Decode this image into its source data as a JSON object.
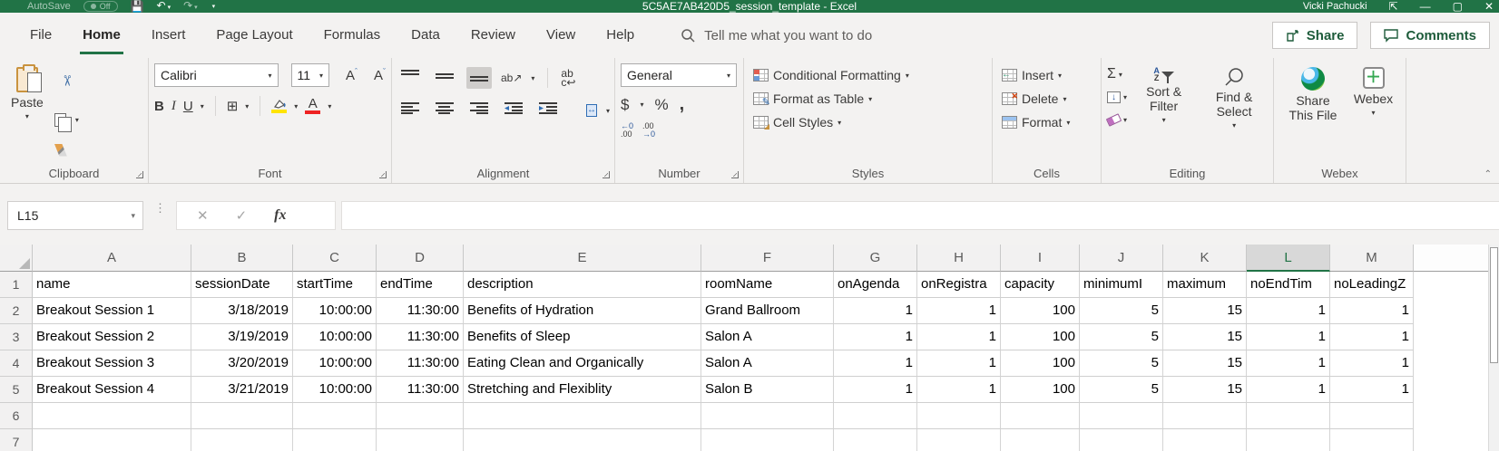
{
  "colors": {
    "accent_green": "#217346",
    "fill_yellow": "#ffe400",
    "font_red": "#ee2222"
  },
  "title_bar": {
    "autosave_label": "AutoSave",
    "autosave_state": "Off",
    "document_title": "5C5AE7AB420D5_session_template  -  Excel",
    "user_name": "Vicki Pachucki"
  },
  "tabs": {
    "labels": [
      "File",
      "Home",
      "Insert",
      "Page Layout",
      "Formulas",
      "Data",
      "Review",
      "View",
      "Help"
    ],
    "active": "Home"
  },
  "search": {
    "label": "Tell me what you want to do"
  },
  "actions": {
    "share": "Share",
    "comments": "Comments"
  },
  "ribbon": {
    "clipboard": {
      "group_label": "Clipboard",
      "paste": "Paste"
    },
    "font": {
      "group_label": "Font",
      "font_name": "Calibri",
      "font_size": "11",
      "bold": "B",
      "italic": "I",
      "underline": "U",
      "color_letter": "A"
    },
    "alignment": {
      "group_label": "Alignment",
      "wrap_text": "abc",
      "orientation": "ab"
    },
    "number": {
      "group_label": "Number",
      "format": "General",
      "currency": "$",
      "percent": "%",
      "comma": ",",
      "inc_decimal_top": "←0",
      "inc_decimal_bottom": ".00",
      "dec_decimal_top": ".00",
      "dec_decimal_bottom": "→0"
    },
    "styles": {
      "group_label": "Styles",
      "conditional_formatting": "Conditional Formatting",
      "format_as_table": "Format as Table",
      "cell_styles": "Cell Styles"
    },
    "cells": {
      "group_label": "Cells",
      "insert": "Insert",
      "delete": "Delete",
      "format": "Format"
    },
    "editing": {
      "group_label": "Editing",
      "autosum": "Σ",
      "fill_arrow": "↓",
      "sort_a": "A",
      "sort_z": "Z",
      "sort_filter": "Sort & Filter",
      "find_select": "Find & Select"
    },
    "webex": {
      "group_label": "Webex",
      "share_this_file": "Share This File",
      "webex_button": "Webex"
    }
  },
  "formula_bar": {
    "name_box": "L15",
    "cancel": "✕",
    "enter": "✓",
    "fx_label": "fx",
    "formula_value": ""
  },
  "grid": {
    "selected_column": "L",
    "column_letters": [
      "A",
      "B",
      "C",
      "D",
      "E",
      "F",
      "G",
      "H",
      "I",
      "J",
      "K",
      "L",
      "M"
    ],
    "row_numbers": [
      "1",
      "2",
      "3",
      "4",
      "5",
      "6",
      "7"
    ],
    "rows": [
      [
        "name",
        "sessionDate",
        "startTime",
        "endTime",
        "description",
        "roomName",
        "onAgenda",
        "onRegistra",
        "capacity",
        "minimumI",
        "maximum",
        "noEndTim",
        "noLeadingZ"
      ],
      [
        "Breakout Session 1",
        "3/18/2019",
        "10:00:00",
        "11:30:00",
        "Benefits of Hydration",
        "Grand Ballroom",
        "1",
        "1",
        "100",
        "5",
        "15",
        "1",
        "1"
      ],
      [
        "Breakout Session 2",
        "3/19/2019",
        "10:00:00",
        "11:30:00",
        "Benefits of Sleep",
        "Salon A",
        "1",
        "1",
        "100",
        "5",
        "15",
        "1",
        "1"
      ],
      [
        "Breakout Session 3",
        "3/20/2019",
        "10:00:00",
        "11:30:00",
        "Eating Clean and Organically",
        "Salon A",
        "1",
        "1",
        "100",
        "5",
        "15",
        "1",
        "1"
      ],
      [
        "Breakout Session 4",
        "3/21/2019",
        "10:00:00",
        "11:30:00",
        "Stretching and Flexiblity",
        "Salon B",
        "1",
        "1",
        "100",
        "5",
        "15",
        "1",
        "1"
      ],
      [
        "",
        "",
        "",
        "",
        "",
        "",
        "",
        "",
        "",
        "",
        "",
        "",
        ""
      ],
      [
        "",
        "",
        "",
        "",
        "",
        "",
        "",
        "",
        "",
        "",
        "",
        "",
        ""
      ]
    ]
  }
}
